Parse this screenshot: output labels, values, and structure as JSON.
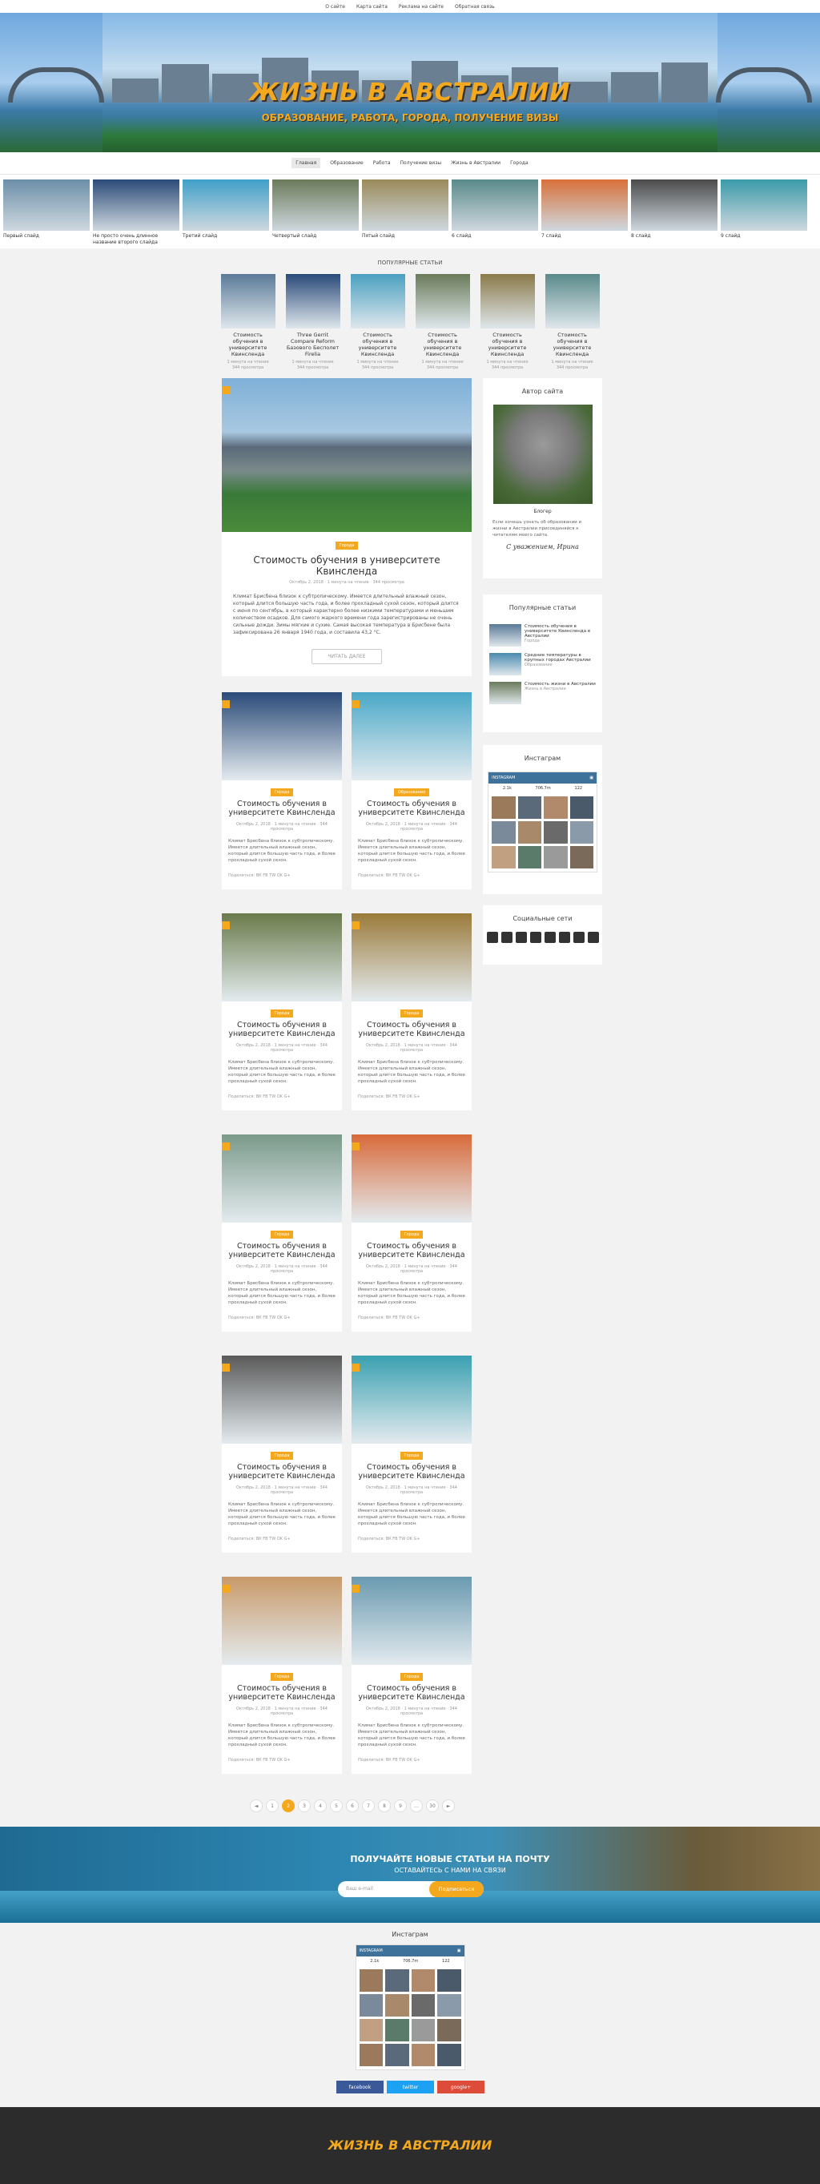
{
  "topbar": [
    "О сайте",
    "Карта сайта",
    "Реклама на сайте",
    "Обратная связь"
  ],
  "header": {
    "logo": "ЖИЗНЬ В АВСТРАЛИИ",
    "tagline": "ОБРАЗОВАНИЕ, РАБОТА, ГОРОДА, ПОЛУЧЕНИЕ ВИЗЫ"
  },
  "nav": [
    "Главная",
    "Образование",
    "Работа",
    "Получение визы",
    "Жизнь в Австралии",
    "Города"
  ],
  "slider": [
    {
      "cap": "Первый слайд",
      "c": "#6b8fa8"
    },
    {
      "cap": "Не просто очень длинное название второго слайда",
      "c": "#2a4a78"
    },
    {
      "cap": "Третий слайд",
      "c": "#3fa0c8"
    },
    {
      "cap": "Четвертый слайд",
      "c": "#6a7a5a"
    },
    {
      "cap": "Пятый слайд",
      "c": "#9a8a5a"
    },
    {
      "cap": "6 слайд",
      "c": "#5a8a8a"
    },
    {
      "cap": "7 слайд",
      "c": "#d8703a"
    },
    {
      "cap": "8 слайд",
      "c": "#4a4a4a"
    },
    {
      "cap": "9 слайд",
      "c": "#3a9aa8"
    }
  ],
  "popular": {
    "title": "ПОПУЛЯРНЫЕ СТАТЬИ",
    "items": [
      {
        "t": "Стоимость обучения в университете Квинсленда",
        "m1": "1 минута на чтение",
        "m2": "344 просмотра",
        "c": "#5a7a98"
      },
      {
        "t": "Three Gerrit Compare Reform Базового Бесполет Firelia",
        "m1": "1 минута на чтение",
        "m2": "344 просмотра",
        "c": "#2a4a7a"
      },
      {
        "t": "Стоимость обучения в университете Квинсленда",
        "m1": "1 минута на чтение",
        "m2": "344 просмотра",
        "c": "#4aa0c0"
      },
      {
        "t": "Стоимость обучения в университете Квинсленда",
        "m1": "1 минута на чтение",
        "m2": "344 просмотра",
        "c": "#6a7a5a"
      },
      {
        "t": "Стоимость обучения в университете Квинсленда",
        "m1": "1 минута на чтение",
        "m2": "344 просмотра",
        "c": "#8a7a4a"
      },
      {
        "t": "Стоимость обучения в университете Квинсленда",
        "m1": "1 минута на чтение",
        "m2": "344 просмотра",
        "c": "#5a8a8a"
      }
    ]
  },
  "featured": {
    "badge": "Города",
    "title": "Стоимость обучения в университете Квинсленда",
    "meta": "Октябрь 2, 2018  ·  1 минута на чтение  ·  344 просмотра",
    "excerpt": "Климат Брисбена близок к субтропическому. Имеется длительный влажный сезон, который длится большую часть года, и более прохладный сухой сезон, который длится с июня по сентябрь, в который характерно более низкими температурами и меньшим количеством осадков. Для самого жаркого времени года зарегистрированы не очень сильные дожди. Зимы мягкие и сухие. Самая высокая температура в Брисбене была зафиксирована 26 января 1940 года, и составила 43,2 °С.",
    "more": "ЧИТАТЬ ДАЛЕЕ"
  },
  "cards": {
    "badge_city": "Города",
    "badge_edu": "Образование",
    "title": "Стоимость обучения в университете Квинсленда",
    "meta": "Октябрь 2, 2018  ·  1 минута на чтение  ·  344 просмотра",
    "excerpt": "Климат Брисбена близок к субтропическому. Имеется длительный влажный сезон, который длится большую часть года, и более прохладный сухой сезон.",
    "share": "Поделиться: ВК  FB  TW  OK  G+",
    "colors": [
      "#2a4a78",
      "#4aa8c8",
      "#6a7a4a",
      "#9a7a3a",
      "#7a9a8a",
      "#d86a3a",
      "#5a5a5a",
      "#3aa0b0",
      "#c89a6a",
      "#6a9ab0"
    ]
  },
  "sidebar": {
    "author": {
      "h": "Автор сайта",
      "role": "Блогер",
      "text": "Если хочешь узнать об образовании и жизни в Австралии присоединяйся к читателям моего сайта.",
      "sig": "С уважением, Ирина"
    },
    "popular": {
      "h": "Популярные статьи",
      "items": [
        {
          "t": "Стоимость обучения в университете Квинсленда в Австралии",
          "c": "Города"
        },
        {
          "t": "Средние температуры в крупных городах Австралии",
          "c": "Образование"
        },
        {
          "t": "Стоимость жизни в Австралии",
          "c": "Жизнь в Австралии"
        }
      ]
    },
    "instagram": {
      "h": "Инстаграм",
      "user": "INSTAGRAM",
      "stats": [
        "2.1k",
        "706.7m",
        "122"
      ]
    },
    "social": {
      "h": "Социальные сети"
    }
  },
  "pagination": [
    "◄",
    "1",
    "2",
    "3",
    "4",
    "5",
    "6",
    "7",
    "8",
    "9",
    "…",
    "30",
    "►"
  ],
  "subscribe": {
    "h1": "ПОЛУЧАЙТЕ НОВЫЕ СТАТЬИ НА ПОЧТУ",
    "h2": "ОСТАВАЙТЕСЬ С НАМИ НА СВЯЗИ",
    "placeholder": "Ваш e-mail",
    "btn": "Подписаться"
  },
  "insta_bottom": {
    "h": "Инстаграм",
    "user": "INSTAGRAM",
    "stats": [
      "2.1k",
      "706.7m",
      "122"
    ]
  },
  "social_buttons": [
    {
      "l": "facebook",
      "c": "#3b5998"
    },
    {
      "l": "twitter",
      "c": "#1da1f2"
    },
    {
      "l": "google+",
      "c": "#dd4b39"
    }
  ],
  "footer": {
    "logo": "ЖИЗНЬ В АВСТРАЛИИ"
  }
}
